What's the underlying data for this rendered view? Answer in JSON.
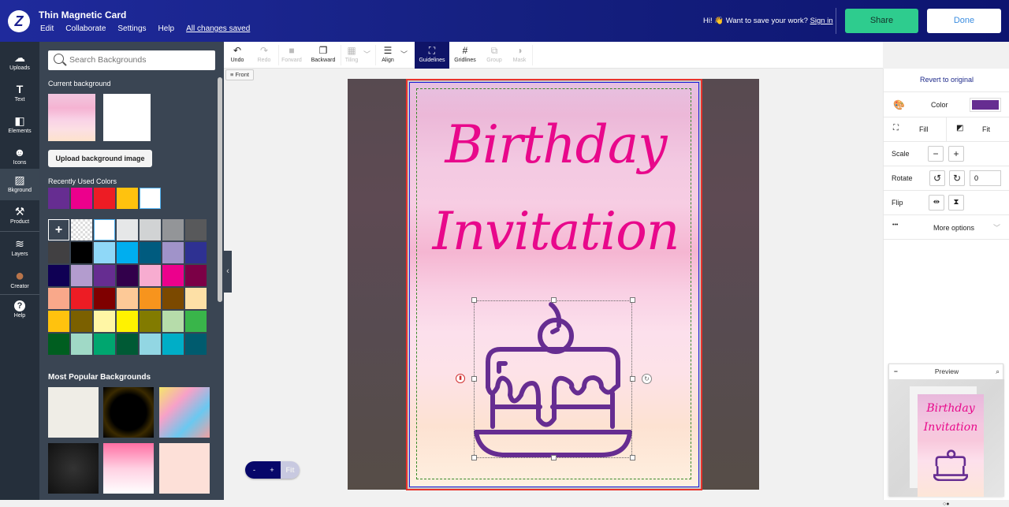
{
  "header": {
    "logo": "Z",
    "title": "Thin Magnetic Card",
    "menu": [
      "Edit",
      "Collaborate",
      "Settings",
      "Help"
    ],
    "save_status": "All changes saved",
    "greeting": "Hi! 👋 Want to save your work?",
    "sign_in": "Sign in",
    "share": "Share",
    "done": "Done"
  },
  "iconbar": [
    {
      "label": "Uploads",
      "icon": "cloud-upload-icon",
      "glyph": "☁"
    },
    {
      "label": "Text",
      "icon": "text-icon",
      "glyph": "T"
    },
    {
      "label": "Elements",
      "icon": "elements-icon",
      "glyph": "◧"
    },
    {
      "label": "Icons",
      "icon": "smiley-icon",
      "glyph": "☻"
    },
    {
      "label": "Bkground",
      "icon": "background-icon",
      "glyph": "▨"
    },
    {
      "label": "Product",
      "icon": "product-icon",
      "glyph": "⚒"
    },
    {
      "label": "Layers",
      "icon": "layers-icon",
      "glyph": "≋"
    },
    {
      "label": "Creator",
      "icon": "creator-avatar",
      "glyph": "●"
    },
    {
      "label": "Help",
      "icon": "help-icon",
      "glyph": "?"
    }
  ],
  "panel": {
    "search_placeholder": "Search Backgrounds",
    "current_bg_label": "Current background",
    "upload_label": "Upload background image",
    "recent_label": "Recently Used Colors",
    "recent_colors": [
      "#662d91",
      "#ec008c",
      "#ed1c24",
      "#ffc20e",
      "#ffffff"
    ],
    "palette": [
      "add",
      "transparent",
      "#ffffff",
      "#e6e7e8",
      "#d1d3d4",
      "#939598",
      "#58595b",
      "#414042",
      "#000000",
      "#8fd8f8",
      "#00aeef",
      "#005b7f",
      "#a093c9",
      "#2e3192",
      "#0f0054",
      "#b39cce",
      "#662d91",
      "#32004b",
      "#f7acd0",
      "#ec008c",
      "#7b0046",
      "#f9a88a",
      "#ed1c24",
      "#7f0000",
      "#fdc997",
      "#f7941d",
      "#7b4900",
      "#fde0a6",
      "#ffc20e",
      "#7b6000",
      "#fff6a5",
      "#fff200",
      "#827b00",
      "#b6dcaa",
      "#39b54a",
      "#005e20",
      "#a0d9c6",
      "#00a66f",
      "#005a35",
      "#92d6e3",
      "#00aec7",
      "#005b6e"
    ],
    "popular_label": "Most Popular Backgrounds"
  },
  "toolbar": [
    {
      "label": "Undo",
      "glyph": "↶",
      "icon": "undo-icon",
      "disabled": false
    },
    {
      "label": "Redo",
      "glyph": "↷",
      "icon": "redo-icon",
      "disabled": true
    },
    {
      "label": "Forward",
      "glyph": "■",
      "icon": "forward-icon",
      "disabled": true
    },
    {
      "label": "Backward",
      "glyph": "❐",
      "icon": "backward-icon",
      "disabled": false
    },
    {
      "label": "Tiling",
      "glyph": "▦",
      "icon": "tiling-icon",
      "disabled": true
    },
    {
      "label": "Align",
      "glyph": "☰",
      "icon": "align-icon",
      "disabled": false
    },
    {
      "label": "Guidelines",
      "glyph": "⛶",
      "icon": "guidelines-icon",
      "disabled": false,
      "active": true
    },
    {
      "label": "Gridlines",
      "glyph": "#",
      "icon": "gridlines-icon",
      "disabled": false
    },
    {
      "label": "Group",
      "glyph": "⧉",
      "icon": "group-icon",
      "disabled": true
    },
    {
      "label": "Mask",
      "glyph": "◑",
      "icon": "mask-icon",
      "disabled": true
    }
  ],
  "canvas": {
    "side_tag": "Front",
    "title_line1": "Birthday",
    "title_line2": "Invitation",
    "title_color": "#e8088b",
    "icon_color": "#662d91",
    "zoom_out": "-",
    "zoom_in": "+",
    "zoom_fit": "Fit"
  },
  "rpanel": {
    "revert": "Revert to original",
    "color_label": "Color",
    "color_value": "#662d91",
    "fill": "Fill",
    "fit": "Fit",
    "scale": "Scale",
    "rotate": "Rotate",
    "rotate_value": "0",
    "flip": "Flip",
    "more": "More options",
    "more_dots": "•••"
  },
  "preview": {
    "title": "Preview",
    "line1": "Birthday",
    "line2": "Invitation",
    "dots": "○●"
  }
}
